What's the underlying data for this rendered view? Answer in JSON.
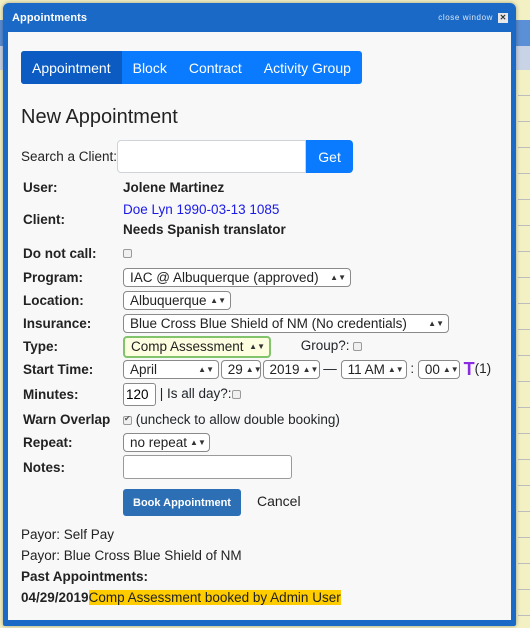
{
  "window": {
    "title": "Appointments",
    "close_label": "close window",
    "close_icon": "close-x-icon"
  },
  "tabs": [
    {
      "label": "Appointment",
      "active": true
    },
    {
      "label": "Block",
      "active": false
    },
    {
      "label": "Contract",
      "active": false
    },
    {
      "label": "Activity Group",
      "active": false
    }
  ],
  "heading": "New Appointment",
  "search": {
    "label": "Search a Client:",
    "value": "",
    "placeholder": "",
    "button": "Get"
  },
  "form": {
    "user_label": "User:",
    "user_value": "Jolene Martinez",
    "client_label": "Client:",
    "client_link": "Doe Lyn 1990-03-13 1085",
    "client_note": "Needs Spanish translator",
    "do_not_call_label": "Do not call:",
    "do_not_call_checked": false,
    "program_label": "Program:",
    "program_value": "IAC @ Albuquerque (approved)",
    "location_label": "Location:",
    "location_value": "Albuquerque",
    "insurance_label": "Insurance:",
    "insurance_value": "Blue Cross Blue Shield of NM (No credentials)",
    "type_label": "Type:",
    "type_value": "Comp Assessment",
    "group_label": "Group?:",
    "group_checked": false,
    "start_label": "Start Time:",
    "start_month": "April",
    "start_day": "29",
    "start_year": "2019",
    "dash": "—",
    "start_hour": "11 AM",
    "colon": ":",
    "start_minute": "00",
    "t_icon": "T",
    "t_count": "(1)",
    "minutes_label": "Minutes:",
    "minutes_value": "120",
    "all_day_label": "| Is all day?:",
    "all_day_checked": false,
    "warn_label": "Warn Overlap",
    "warn_checked": true,
    "warn_note": "(uncheck to allow double booking)",
    "repeat_label": "Repeat:",
    "repeat_value": "no repeat",
    "notes_label": "Notes:",
    "notes_value": "",
    "book_button": "Book Appointment",
    "cancel_button": "Cancel"
  },
  "footer": {
    "payors": [
      "Payor: Self Pay",
      "Payor: Blue Cross Blue Shield of NM"
    ],
    "past_label": "Past Appointments:",
    "past": [
      {
        "date": "04/29/2019",
        "text": "Comp Assessment booked by Admin User"
      }
    ]
  },
  "colors": {
    "titlebar": "#1b69c6",
    "tab_bg": "#0a7bff",
    "tab_active": "#0b5bc2",
    "book_btn": "#2c6fb5",
    "highlight": "#ffcc00",
    "link": "#1a1ae6",
    "t_icon": "#8a2be2"
  }
}
